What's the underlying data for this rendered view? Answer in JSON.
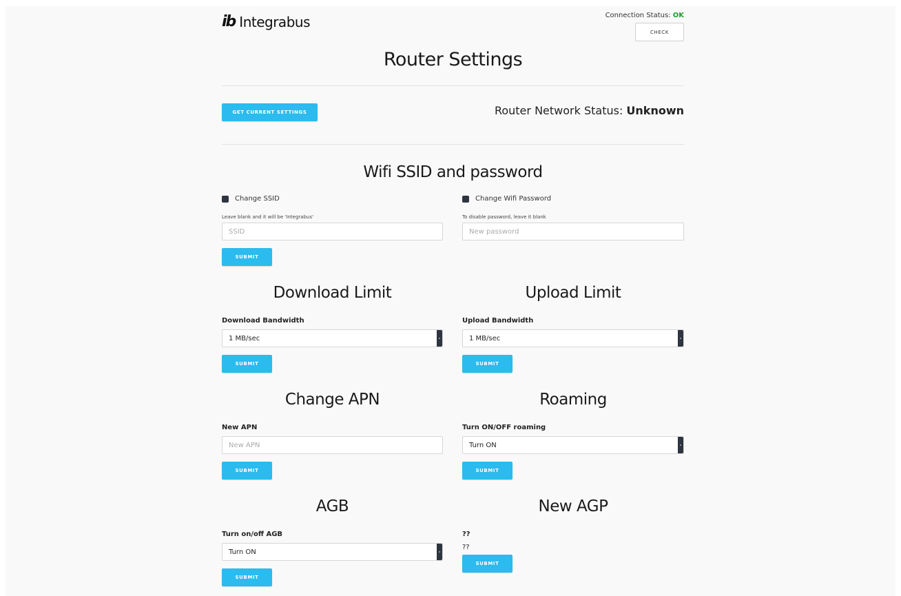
{
  "header": {
    "brand_mark": "ib",
    "brand_name": "Integrabus",
    "connection_label": "Connection Status: ",
    "connection_value": "OK",
    "check_label": "CHECK"
  },
  "page_title": "Router Settings",
  "status_bar": {
    "get_settings_label": "GET CURRENT SETTINGS",
    "network_status_label": "Router Network Status: ",
    "network_status_value": "Unknown"
  },
  "wifi": {
    "title": "Wifi SSID and password",
    "change_ssid_label": "Change SSID",
    "change_password_label": "Change Wifi Password",
    "ssid_hint": "Leave blank and it will be 'Integrabus'",
    "ssid_placeholder": "SSID",
    "password_hint": "To disable password, leave it blank",
    "password_placeholder": "New password",
    "submit_label": "SUBMIT"
  },
  "download": {
    "title": "Download Limit",
    "label": "Download Bandwidth",
    "selected": "1 MB/sec",
    "submit_label": "SUBMIT"
  },
  "upload": {
    "title": "Upload Limit",
    "label": "Upload Bandwidth",
    "selected": "1 MB/sec",
    "submit_label": "SUBMIT"
  },
  "apn": {
    "title": "Change APN",
    "label": "New APN",
    "placeholder": "New APN",
    "submit_label": "SUBMIT"
  },
  "roaming": {
    "title": "Roaming",
    "label": "Turn ON/OFF roaming",
    "selected": "Turn ON",
    "submit_label": "SUBMIT"
  },
  "agb": {
    "title": "AGB",
    "label": "Turn on/off AGB",
    "selected": "Turn ON",
    "submit_label": "SUBMIT"
  },
  "agp": {
    "title": "New AGP",
    "label": "??",
    "value": "??",
    "submit_label": "SUBMIT"
  },
  "colors": {
    "primary": "#2bbbee",
    "ok": "#1d9e2a",
    "checkbox": "#2e3440"
  }
}
